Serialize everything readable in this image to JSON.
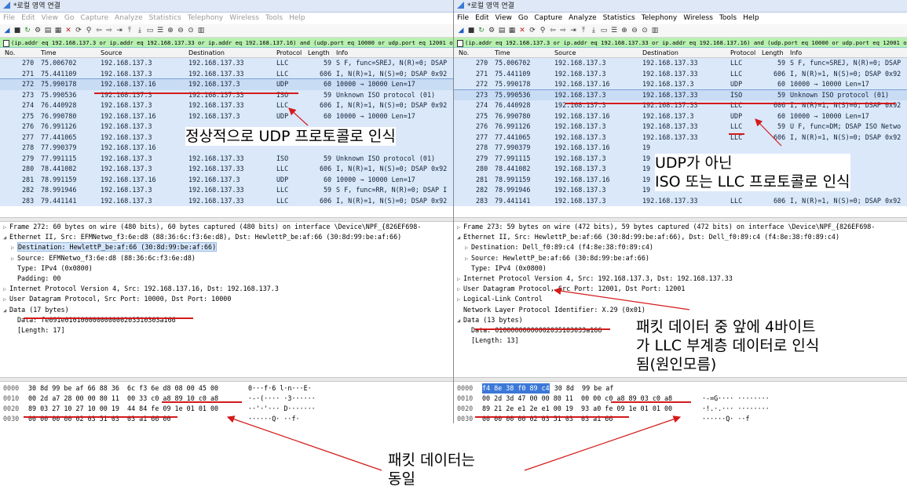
{
  "left": {
    "title": "*로컬 영역 연결",
    "menu": [
      "File",
      "Edit",
      "View",
      "Go",
      "Capture",
      "Analyze",
      "Statistics",
      "Telephony",
      "Wireless",
      "Tools",
      "Help"
    ],
    "filter": "(ip.addr eq 192.168.137.3 or ip.addr eq 192.168.137.33 or ip.addr eq 192.168.137.16) and (udp.port eq 10000 or udp.port eq 12001 or udp.port eq 12002)",
    "columns": [
      "No.",
      "Time",
      "Source",
      "Destination",
      "Protocol",
      "Length",
      "Info"
    ],
    "rows": [
      [
        "270",
        "75.006702",
        "192.168.137.3",
        "192.168.137.33",
        "LLC",
        "59",
        "S F, func=SREJ, N(R)=0; DSAP"
      ],
      [
        "271",
        "75.441109",
        "192.168.137.3",
        "192.168.137.33",
        "LLC",
        "606",
        "I, N(R)=1, N(S)=0; DSAP 0x92"
      ],
      [
        "272",
        "75.990178",
        "192.168.137.16",
        "192.168.137.3",
        "UDP",
        "60",
        "10000 → 10000 Len=17"
      ],
      [
        "273",
        "75.990536",
        "192.168.137.3",
        "192.168.137.33",
        "ISO",
        "59",
        "Unknown ISO protocol (01)"
      ],
      [
        "274",
        "76.440928",
        "192.168.137.3",
        "192.168.137.33",
        "LLC",
        "606",
        "I, N(R)=1, N(S)=0; DSAP 0x92"
      ],
      [
        "275",
        "76.990780",
        "192.168.137.16",
        "192.168.137.3",
        "UDP",
        "60",
        "10000 → 10000 Len=17"
      ],
      [
        "276",
        "76.991126",
        "192.168.137.3",
        "",
        "",
        "",
        ""
      ],
      [
        "277",
        "77.441065",
        "192.168.137.3",
        "",
        "",
        "",
        ""
      ],
      [
        "278",
        "77.990379",
        "192.168.137.16",
        "",
        "",
        "",
        ""
      ],
      [
        "279",
        "77.991115",
        "192.168.137.3",
        "192.168.137.33",
        "ISO",
        "59",
        "Unknown ISO protocol (01)"
      ],
      [
        "280",
        "78.441082",
        "192.168.137.3",
        "192.168.137.33",
        "LLC",
        "606",
        "I, N(R)=1, N(S)=0; DSAP 0x92"
      ],
      [
        "281",
        "78.991159",
        "192.168.137.16",
        "192.168.137.3",
        "UDP",
        "60",
        "10000 → 10000 Len=17"
      ],
      [
        "282",
        "78.991946",
        "192.168.137.3",
        "192.168.137.33",
        "LLC",
        "59",
        "S F, func=RR, N(R)=0; DSAP I"
      ],
      [
        "283",
        "79.441141",
        "192.168.137.3",
        "192.168.137.33",
        "LLC",
        "606",
        "I, N(R)=1, N(S)=0; DSAP 0x92"
      ]
    ],
    "details": [
      {
        "ind": 0,
        "tri": "▷",
        "text": "Frame 272: 60 bytes on wire (480 bits), 60 bytes captured (480 bits) on interface \\Device\\NPF_{826EF698-"
      },
      {
        "ind": 0,
        "tri": "◢",
        "text": "Ethernet II, Src: EFMNetwo_f3:6e:d8 (88:36:6c:f3:6e:d8), Dst: HewlettP_be:af:66 (30:8d:99:be:af:66)"
      },
      {
        "ind": 1,
        "tri": "▷",
        "text": "Destination: HewlettP_be:af:66 (30:8d:99:be:af:66)",
        "hl": true
      },
      {
        "ind": 1,
        "tri": "▷",
        "text": "Source: EFMNetwo_f3:6e:d8 (88:36:6c:f3:6e:d8)"
      },
      {
        "ind": 1,
        "tri": "",
        "text": "Type: IPv4 (0x0800)"
      },
      {
        "ind": 1,
        "tri": "",
        "text": "Padding: 00"
      },
      {
        "ind": 0,
        "tri": "▷",
        "text": "Internet Protocol Version 4, Src: 192.168.137.16, Dst: 192.168.137.3"
      },
      {
        "ind": 0,
        "tri": "▷",
        "text": "User Datagram Protocol, Src Port: 10000, Dst Port: 10000"
      },
      {
        "ind": 0,
        "tri": "◢",
        "text": "Data (17 bytes)"
      },
      {
        "ind": 1,
        "tri": "",
        "text": "Data: fe091e010100000000000203510303a166"
      },
      {
        "ind": 1,
        "tri": "",
        "text": "[Length: 17]"
      }
    ],
    "hex": [
      {
        "off": "0000",
        "bytes": "30 8d 99 be af 66 88 36  6c f3 6e d8 08 00 45 00",
        "ascii": "0···f·6 l·n···E·"
      },
      {
        "off": "0010",
        "bytes": "00 2d a7 28 00 00 80 11  00 33 c0 a8 89 10 c0 a8",
        "ascii": "·-·(···· ·3······"
      },
      {
        "off": "0020",
        "bytes": "89 03 27 10 27 10 00 19  44 84 fe 09 1e 01 01 00",
        "ascii": "··'·'··· D·······"
      },
      {
        "off": "0030",
        "bytes": "00 00 00 00 02 03 51 03  03 a1 66 00",
        "ascii": "······Q· ··f·"
      }
    ]
  },
  "right": {
    "title": "*로컬 영역 연결",
    "menu": [
      "File",
      "Edit",
      "View",
      "Go",
      "Capture",
      "Analyze",
      "Statistics",
      "Telephony",
      "Wireless",
      "Tools",
      "Help"
    ],
    "filter": "(ip.addr eq 192.168.137.3 or ip.addr eq 192.168.137.33 or ip.addr eq 192.168.137.16) and (udp.port eq 10000 or udp.port eq 12001 or udp.port eq 12002)",
    "columns": [
      "No.",
      "Time",
      "Source",
      "Destination",
      "Protocol",
      "Length",
      "Info"
    ],
    "rows": [
      [
        "270",
        "75.006702",
        "192.168.137.3",
        "192.168.137.33",
        "LLC",
        "59",
        "S F, func=SREJ, N(R)=0; DSAP"
      ],
      [
        "271",
        "75.441109",
        "192.168.137.3",
        "192.168.137.33",
        "LLC",
        "606",
        "I, N(R)=1, N(S)=0; DSAP 0x92"
      ],
      [
        "272",
        "75.990178",
        "192.168.137.16",
        "192.168.137.3",
        "UDP",
        "60",
        "10000 → 10000 Len=17"
      ],
      [
        "273",
        "75.990536",
        "192.168.137.3",
        "192.168.137.33",
        "ISO",
        "59",
        "Unknown ISO protocol (01)"
      ],
      [
        "274",
        "76.440928",
        "192.168.137.3",
        "192.168.137.33",
        "LLC",
        "606",
        "I, N(R)=1, N(S)=0; DSAP 0x92"
      ],
      [
        "275",
        "76.990780",
        "192.168.137.16",
        "192.168.137.3",
        "UDP",
        "60",
        "10000 → 10000 Len=17"
      ],
      [
        "276",
        "76.991126",
        "192.168.137.3",
        "192.168.137.33",
        "LLC",
        "59",
        "U F, func=DM; DSAP ISO Netwo"
      ],
      [
        "277",
        "77.441065",
        "192.168.137.3",
        "192.168.137.33",
        "LLC",
        "606",
        "I, N(R)=1, N(S)=0; DSAP 0x92"
      ],
      [
        "278",
        "77.990379",
        "192.168.137.16",
        "19",
        "",
        "",
        ""
      ],
      [
        "279",
        "77.991115",
        "192.168.137.3",
        "19",
        "",
        "",
        ""
      ],
      [
        "280",
        "78.441082",
        "192.168.137.3",
        "19",
        "",
        "",
        ""
      ],
      [
        "281",
        "78.991159",
        "192.168.137.16",
        "19",
        "",
        "",
        ""
      ],
      [
        "282",
        "78.991946",
        "192.168.137.3",
        "19",
        "",
        "",
        ""
      ],
      [
        "283",
        "79.441141",
        "192.168.137.3",
        "192.168.137.33",
        "LLC",
        "606",
        "I, N(R)=1, N(S)=0; DSAP 0x92"
      ]
    ],
    "details": [
      {
        "ind": 0,
        "tri": "▷",
        "text": "Frame 273: 59 bytes on wire (472 bits), 59 bytes captured (472 bits) on interface \\Device\\NPF_{826EF698-"
      },
      {
        "ind": 0,
        "tri": "◢",
        "text": "Ethernet II, Src: HewlettP_be:af:66 (30:8d:99:be:af:66), Dst: Dell_f0:89:c4 (f4:8e:38:f0:89:c4)"
      },
      {
        "ind": 1,
        "tri": "▷",
        "text": "Destination: Dell_f0:89:c4 (f4:8e:38:f0:89:c4)"
      },
      {
        "ind": 1,
        "tri": "▷",
        "text": "Source: HewlettP_be:af:66 (30:8d:99:be:af:66)"
      },
      {
        "ind": 1,
        "tri": "",
        "text": "Type: IPv4 (0x0800)"
      },
      {
        "ind": 0,
        "tri": "▷",
        "text": "Internet Protocol Version 4, Src: 192.168.137.3, Dst: 192.168.137.33"
      },
      {
        "ind": 0,
        "tri": "▷",
        "text": "User Datagram Protocol, Src Port: 12001, Dst Port: 12001"
      },
      {
        "ind": 0,
        "tri": "▷",
        "text": "Logical-Link Control"
      },
      {
        "ind": 0,
        "tri": "",
        "text": "Network Layer Protocol Identifier: X.29 (0x01)"
      },
      {
        "ind": 0,
        "tri": "◢",
        "text": "Data (13 bytes)"
      },
      {
        "ind": 1,
        "tri": "",
        "text": "Data: 01000000000002035103033a166"
      },
      {
        "ind": 1,
        "tri": "",
        "text": "[Length: 13]"
      }
    ],
    "hex": [
      {
        "off": "0000",
        "sel": "f4 8e 38 f0 89 c4",
        "bytes": " 30 8d  99 be af",
        "ascii": ""
      },
      {
        "off": "0010",
        "sel": "",
        "bytes": "00 2d 3d 47 00 00 80 11  00 00 c0 a8 89 03 c0 a8",
        "ascii": "·-=G···· ········"
      },
      {
        "off": "0020",
        "sel": "",
        "bytes": "89 21 2e e1 2e e1 00 19  93 a0 fe 09 1e 01 01 00",
        "ascii": "·!.·.··· ········"
      },
      {
        "off": "0030",
        "sel": "",
        "bytes": "00 00 00 00 02 03 51 03  03 a1 66",
        "ascii": "······Q· ··f"
      }
    ]
  },
  "annotations": {
    "udp_recognized": "정상적으로 UDP 프로토콜로 인식",
    "not_udp_line1": "UDP가 아닌",
    "not_udp_line2": "ISO 또는 LLC 프로토콜로 인식",
    "llc_line1": "패킷 데이터 중 앞에 4바이트",
    "llc_line2": "가 LLC 부계층 데이터로 인식",
    "llc_line3": "됨(원인모름)",
    "same_line1": "패킷 데이터는",
    "same_line2": "동일"
  },
  "colors": {
    "annotation_red": "#d41a1a",
    "filter_green": "#b8f0b0",
    "row_blue": "#dae8fa",
    "hex_select": "#3b78d8"
  }
}
